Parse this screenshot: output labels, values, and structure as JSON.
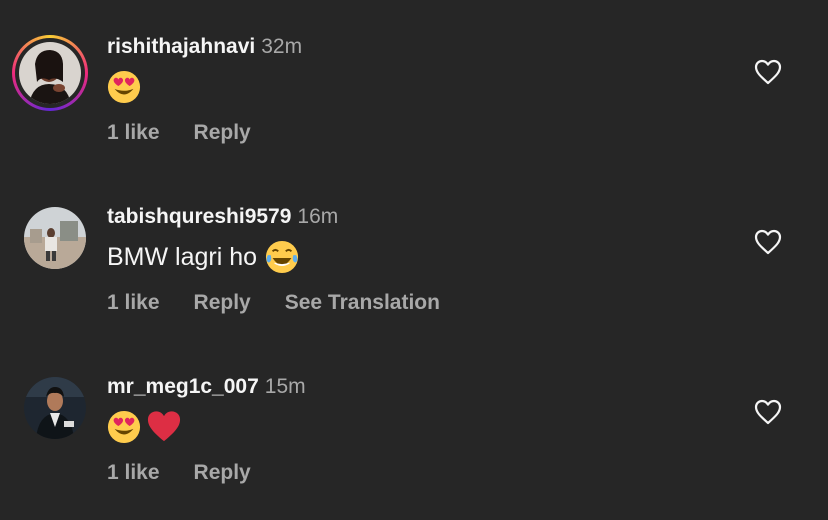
{
  "comments": [
    {
      "username": "rishithajahnavi",
      "time": "32m",
      "text": "",
      "emojis": [
        "heart-eyes-emoji"
      ],
      "likes": "1 like",
      "reply": "Reply",
      "translate": ""
    },
    {
      "username": "tabishqureshi9579",
      "time": "16m",
      "text": "BMW lagri ho",
      "emojis": [
        "tears-of-joy-emoji"
      ],
      "likes": "1 like",
      "reply": "Reply",
      "translate": "See Translation"
    },
    {
      "username": "mr_meg1c_007",
      "time": "15m",
      "text": "",
      "emojis": [
        "heart-eyes-emoji",
        "red-heart-emoji"
      ],
      "likes": "1 like",
      "reply": "Reply",
      "translate": ""
    }
  ],
  "colors": {
    "background": "#262626",
    "primary_text": "#f5f5f5",
    "secondary_text": "#a8a8a8",
    "story_ring": [
      "#f9ce34",
      "#ee2a7b",
      "#6228d7"
    ]
  },
  "icons": {
    "like": "heart-outline-icon"
  }
}
